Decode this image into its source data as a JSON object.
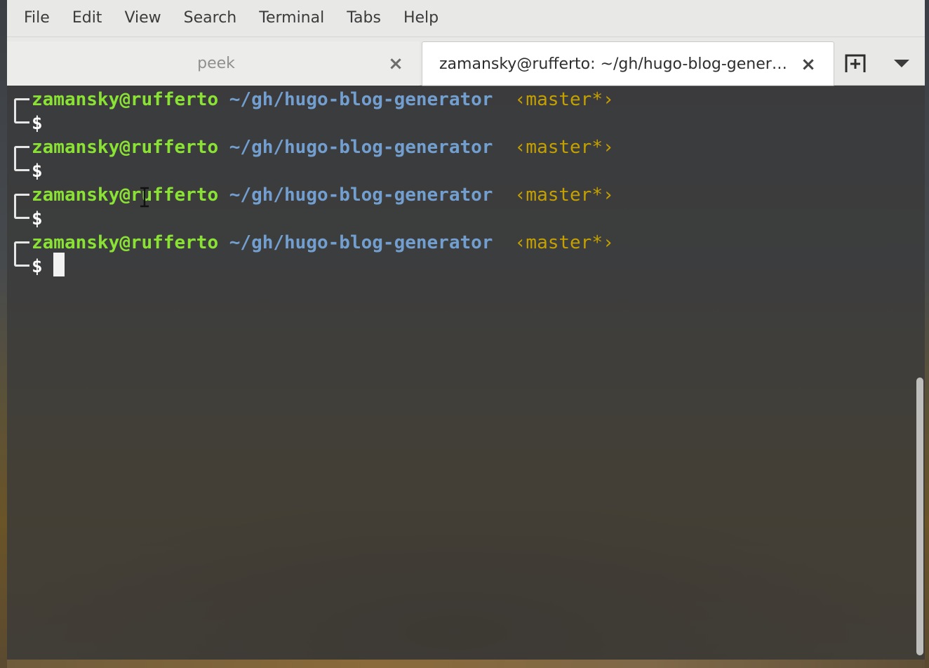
{
  "menubar": {
    "items": [
      "File",
      "Edit",
      "View",
      "Search",
      "Terminal",
      "Tabs",
      "Help"
    ]
  },
  "tabs": [
    {
      "label": "peek",
      "active": false
    },
    {
      "label": "zamansky@rufferto: ~/gh/hugo-blog-generator",
      "active": true
    }
  ],
  "terminal": {
    "prompts": [
      {
        "user": "zamansky@rufferto",
        "path": "~/gh/hugo-blog-generator",
        "branch": "‹master*›",
        "symbol": "$"
      },
      {
        "user": "zamansky@rufferto",
        "path": "~/gh/hugo-blog-generator",
        "branch": "‹master*›",
        "symbol": "$"
      },
      {
        "user": "zamansky@rufferto",
        "path": "~/gh/hugo-blog-generator",
        "branch": "‹master*›",
        "symbol": "$"
      },
      {
        "user": "zamansky@rufferto",
        "path": "~/gh/hugo-blog-generator",
        "branch": "‹master*›",
        "symbol": "$"
      }
    ]
  },
  "colors": {
    "user": "#8ae234",
    "path": "#729fcf",
    "branch": "#c4a000",
    "terminal_bg": "#3a3a3a",
    "chrome_bg": "#e8e8e7"
  },
  "icons": {
    "tab_close": "close-icon",
    "new_tab": "new-tab-icon",
    "tabs_menu": "chevron-down-icon"
  }
}
